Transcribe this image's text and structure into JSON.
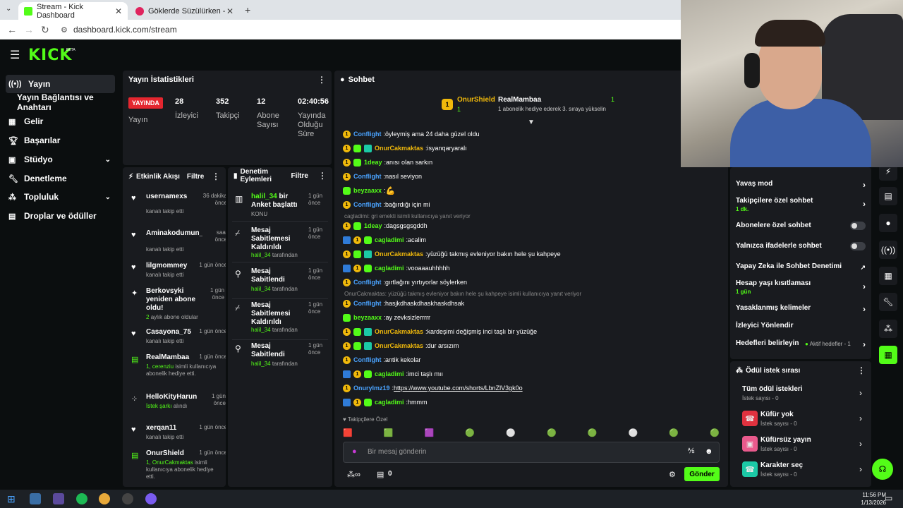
{
  "browser": {
    "tabs": [
      {
        "title": "Stream - Kick Dashboard"
      },
      {
        "title": "Göklerde Süzülürken - YouT"
      }
    ],
    "url": "dashboard.kick.com/stream"
  },
  "kick": {
    "logo": "KICK",
    "beta": "BETA"
  },
  "sidebar": {
    "items": [
      {
        "label": "Yayın",
        "icon": "broadcast-icon"
      },
      {
        "label": "Yayın Bağlantısı ve Anahtarı"
      },
      {
        "label": "Gelir",
        "icon": "revenue-icon"
      },
      {
        "label": "Başarılar",
        "icon": "trophy-icon"
      },
      {
        "label": "Stüdyo",
        "icon": "studio-icon"
      },
      {
        "label": "Denetleme",
        "icon": "wrench-icon"
      },
      {
        "label": "Topluluk",
        "icon": "community-icon"
      },
      {
        "label": "Droplar ve ödüller",
        "icon": "gift-icon"
      }
    ]
  },
  "stats": {
    "title": "Yayın İstatistikleri",
    "live_label": "YAYINDA",
    "live_sub": "Yayın",
    "items": [
      {
        "value": "28",
        "label": "İzleyici"
      },
      {
        "value": "352",
        "label": "Takipçi"
      },
      {
        "value": "12",
        "label": "Abone Sayısı"
      },
      {
        "value": "02:40:56",
        "label": "Yayında Olduğu Süre"
      }
    ]
  },
  "activity": {
    "title": "Etkinlik Akışı",
    "filter": "Filtre",
    "items": [
      {
        "name": "usernamexs",
        "time": "36 dakika önce",
        "sub": "kanalı takip etti"
      },
      {
        "name": "Aminakodumun_pici",
        "time": "saat önce",
        "sub": "kanalı takip etti"
      },
      {
        "name": "lilgmommey",
        "time": "1 gün önce",
        "sub": "kanalı takip etti"
      },
      {
        "name": "Berkovsyki yeniden abone oldu!",
        "time": "1 gün önce",
        "sub_green": "2",
        "sub": "aylık abone oldular"
      },
      {
        "name": "Casayona_75",
        "time": "1 gün önce",
        "sub": "kanalı takip etti"
      },
      {
        "name": "RealMambaa",
        "time": "1 gün önce",
        "sub_green": "1, cerenziu",
        "sub": "isimli kullanıcıya abonelik hediye etti."
      },
      {
        "name": "HelloKityHarun",
        "time": "1 gün önce",
        "sub_green": "İstek şarkı",
        "sub": "alındı"
      },
      {
        "name": "xerqan11",
        "time": "1 gün önce",
        "sub": "kanalı takip etti"
      },
      {
        "name": "OnurShield",
        "time": "1 gün önce",
        "sub_green": "1, OnurCakmaktas",
        "sub": "isimli kullanıcıya abonelik hediye etti."
      }
    ]
  },
  "moderation": {
    "title": "Denetim Eylemleri",
    "filter": "Filtre",
    "items": [
      {
        "user": "halil_34",
        "title": "bir Anket başlattı",
        "time": "1 gün önce",
        "sub": "KONU"
      },
      {
        "title": "Mesaj Sabitlemesi Kaldırıldı",
        "time": "1 gün önce",
        "user": "halil_34",
        "sub": "tarafından"
      },
      {
        "title": "Mesaj Sabitlendi",
        "time": "1 gün önce",
        "user": "halil_34",
        "sub": "tarafından"
      },
      {
        "title": "Mesaj Sabitlemesi Kaldırıldı",
        "time": "1 gün önce",
        "user": "halil_34",
        "sub": "tarafından"
      },
      {
        "title": "Mesaj Sabitlendi",
        "time": "1 gün önce",
        "user": "halil_34",
        "sub": "tarafından"
      }
    ]
  },
  "chat": {
    "title": "Sohbet",
    "leaders": [
      {
        "rank": "1",
        "name": "OnurShield",
        "count": "1"
      },
      {
        "name": "RealMambaa",
        "count": "1",
        "sub": "1 abonelik hediye ederek 3. sıraya yükselin"
      }
    ],
    "messages": [
      {
        "user": "Conflight",
        "color": "#4aa3ff",
        "text": "öyleymiş ama 24 daha güzel oldu",
        "badges": [
          "gold"
        ]
      },
      {
        "user": "OnurCakmaktas",
        "color": "#f0b90b",
        "text": "isyanqaryaralı",
        "badges": [
          "gold",
          "green",
          "teal"
        ]
      },
      {
        "user": "1deay",
        "color": "#53fc18",
        "text": "anısı olan sarkın",
        "badges": [
          "gold",
          "green"
        ]
      },
      {
        "user": "Conflight",
        "color": "#4aa3ff",
        "text": "nasıl seviyon",
        "badges": [
          "gold"
        ]
      },
      {
        "user": "beyzaaxx",
        "color": "#53fc18",
        "text": "",
        "badges": [
          "green"
        ],
        "emote": "💪"
      },
      {
        "user": "Conflight",
        "color": "#4aa3ff",
        "text": "bağırdığı için mi",
        "badges": [
          "gold"
        ]
      },
      {
        "reply": "cagladimi: gri emekti isimli kullanıcıya yanıt veriyor"
      },
      {
        "user": "1deay",
        "color": "#53fc18",
        "text": "dagsgsgsgddh",
        "badges": [
          "gold",
          "green"
        ]
      },
      {
        "user": "cagladimi",
        "color": "#53fc18",
        "text": "acalim",
        "badges": [
          "blue",
          "gold",
          "green"
        ]
      },
      {
        "user": "OnurCakmaktas",
        "color": "#f0b90b",
        "text": "yüzüğü takmış evleniyor bakın hele şu kahpeye",
        "badges": [
          "gold",
          "green",
          "teal"
        ]
      },
      {
        "user": "cagladimi",
        "color": "#53fc18",
        "text": "vooaaauhhhhh",
        "badges": [
          "blue",
          "gold",
          "green"
        ]
      },
      {
        "user": "Conflight",
        "color": "#4aa3ff",
        "text": "gırtlağını yırtıyorlar söylerken",
        "badges": [
          "gold"
        ]
      },
      {
        "reply": "OnurCakmaktas: yüzüğü takmış evleniyor bakın hele şu kahpeye isimli kullanıcıya yanıt veriyor"
      },
      {
        "user": "Conflight",
        "color": "#4aa3ff",
        "text": "hasjkdhaskdhaskhaskdhsak",
        "badges": [
          "gold"
        ]
      },
      {
        "user": "beyzaaxx",
        "color": "#53fc18",
        "text": "ay zevksizlerrrrr",
        "badges": [
          "green"
        ]
      },
      {
        "user": "OnurCakmaktas",
        "color": "#f0b90b",
        "text": "kardeşimi değişmiş inci taşlı bir yüzüğe",
        "badges": [
          "gold",
          "green",
          "teal"
        ]
      },
      {
        "user": "OnurCakmaktas",
        "color": "#f0b90b",
        "text": "dur arsızım",
        "badges": [
          "gold",
          "green",
          "teal"
        ]
      },
      {
        "user": "Conflight",
        "color": "#4aa3ff",
        "text": "antik kekolar",
        "badges": [
          "gold"
        ]
      },
      {
        "user": "cagladimi",
        "color": "#53fc18",
        "text": "imci taşlı mıı",
        "badges": [
          "blue",
          "gold",
          "green"
        ]
      },
      {
        "user": "Onurylmz19",
        "color": "#4aa3ff",
        "text": "https://www.youtube.com/shorts/LbnZlV3gk0o",
        "badges": [
          "gold"
        ],
        "link": true
      },
      {
        "user": "cagladimi",
        "color": "#53fc18",
        "text": "hmmm",
        "badges": [
          "blue",
          "gold",
          "green"
        ]
      }
    ],
    "followers_only": "Takipçilere Özel",
    "placeholder": "Bir mesaj gönderin",
    "points": "0",
    "send": "Gönder"
  },
  "settings": {
    "items": [
      {
        "label": "Yavaş mod",
        "type": "arrow"
      },
      {
        "label": "Takipçilere özel sohbet",
        "sub": "1 dk.",
        "type": "arrow"
      },
      {
        "label": "Abonelere özel sohbet",
        "type": "toggle"
      },
      {
        "label": "Yalnızca ifadelerle sohbet",
        "type": "toggle"
      },
      {
        "label": "Yapay Zeka ile Sohbet Denetimi",
        "type": "external"
      },
      {
        "label": "Hesap yaşı kısıtlaması",
        "sub": "1 gün",
        "type": "arrow"
      },
      {
        "label": "Yasaklanmış kelimeler",
        "type": "arrow"
      },
      {
        "label": "İzleyici Yönlendir",
        "type": "none"
      },
      {
        "label": "Hedefleri belirleyin",
        "status": "Aktif hedefler - 1",
        "type": "arrow"
      }
    ]
  },
  "rewards": {
    "title": "Ödül istek sırası",
    "items": [
      {
        "label": "Tüm ödül istekleri",
        "sub": "İstek sayısı - 0"
      },
      {
        "label": "Küfür yok",
        "sub": "İstek sayısı - 0",
        "color": "#e0323f"
      },
      {
        "label": "Küfürsüz yayın",
        "sub": "İstek sayısı - 0",
        "color": "#e85a8c"
      },
      {
        "label": "Karakter seç",
        "sub": "İstek sayısı - 0",
        "color": "#1bc9a6"
      }
    ]
  },
  "taskbar": {
    "time": "11:56 PM",
    "date": "1/13/2026"
  },
  "colors": {
    "accent": "#53fc18",
    "live": "#e4262f",
    "panel": "#191b1f"
  }
}
